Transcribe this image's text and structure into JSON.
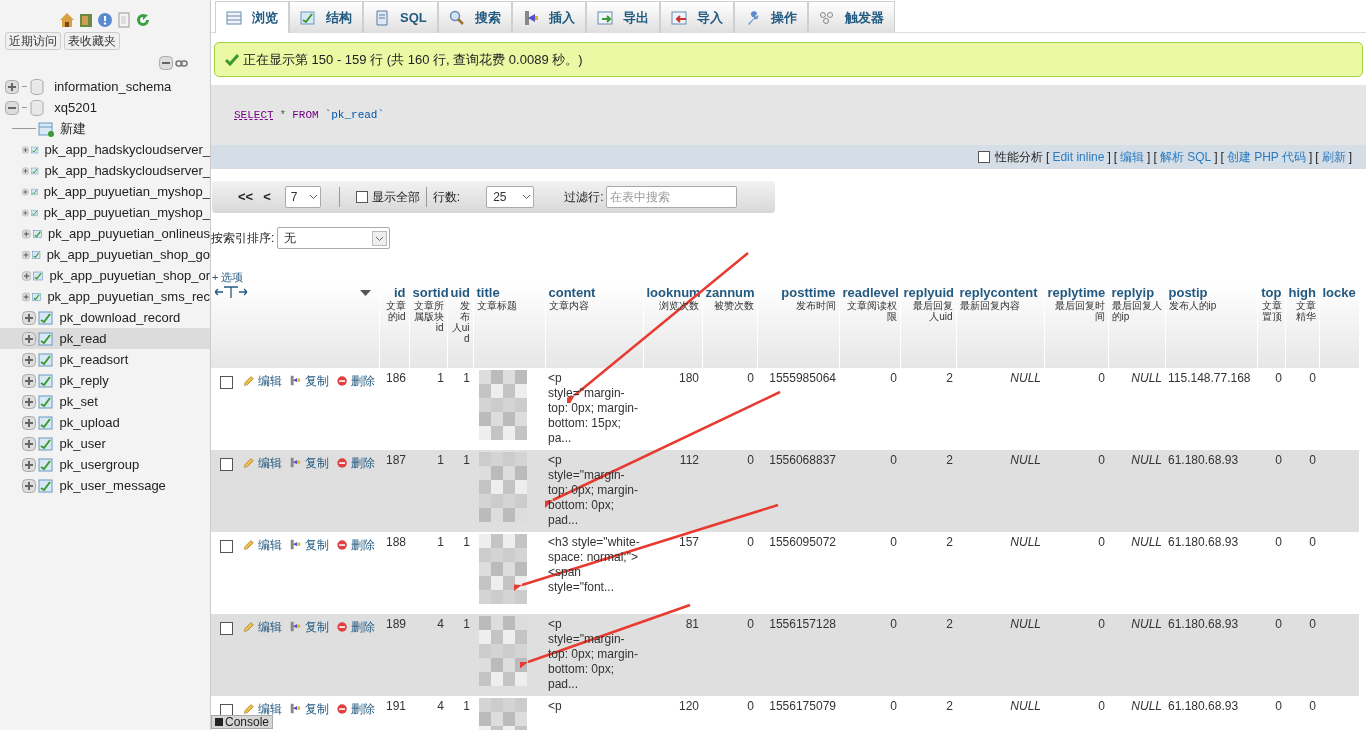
{
  "sidebar": {
    "buttons": [
      "近期访问",
      "表收藏夹"
    ],
    "tree": [
      {
        "label": "information_schema",
        "kind": "database",
        "expanded": false,
        "selected": false
      },
      {
        "label": "xq5201",
        "kind": "database",
        "expanded": true,
        "selected": false,
        "children": [
          {
            "label": "新建",
            "kind": "new",
            "selected": false
          },
          {
            "label": "pk_app_hadskycloudserver_",
            "kind": "table",
            "selected": false
          },
          {
            "label": "pk_app_hadskycloudserver_",
            "kind": "table",
            "selected": false
          },
          {
            "label": "pk_app_puyuetian_myshop_",
            "kind": "table",
            "selected": false
          },
          {
            "label": "pk_app_puyuetian_myshop_",
            "kind": "table",
            "selected": false
          },
          {
            "label": "pk_app_puyuetian_onlineus",
            "kind": "table",
            "selected": false
          },
          {
            "label": "pk_app_puyuetian_shop_go",
            "kind": "table",
            "selected": false
          },
          {
            "label": "pk_app_puyuetian_shop_or",
            "kind": "table",
            "selected": false
          },
          {
            "label": "pk_app_puyuetian_sms_rec",
            "kind": "table",
            "selected": false
          },
          {
            "label": "pk_download_record",
            "kind": "table",
            "selected": false
          },
          {
            "label": "pk_read",
            "kind": "table",
            "selected": true
          },
          {
            "label": "pk_readsort",
            "kind": "table",
            "selected": false
          },
          {
            "label": "pk_reply",
            "kind": "table",
            "selected": false
          },
          {
            "label": "pk_set",
            "kind": "table",
            "selected": false
          },
          {
            "label": "pk_upload",
            "kind": "table",
            "selected": false
          },
          {
            "label": "pk_user",
            "kind": "table",
            "selected": false
          },
          {
            "label": "pk_usergroup",
            "kind": "table",
            "selected": false
          },
          {
            "label": "pk_user_message",
            "kind": "table",
            "selected": false
          }
        ]
      }
    ]
  },
  "tabs": [
    {
      "label": "浏览",
      "selected": true
    },
    {
      "label": "结构",
      "selected": false
    },
    {
      "label": "SQL",
      "selected": false
    },
    {
      "label": "搜索",
      "selected": false
    },
    {
      "label": "插入",
      "selected": false
    },
    {
      "label": "导出",
      "selected": false
    },
    {
      "label": "导入",
      "selected": false
    },
    {
      "label": "操作",
      "selected": false
    },
    {
      "label": "触发器",
      "selected": false
    }
  ],
  "message": "正在显示第 150 - 159 行 (共 160 行, 查询花费 0.0089 秒。)",
  "sql": {
    "keyword1": "SELECT",
    "star": "*",
    "keyword2": "FROM",
    "table": "`pk_read`"
  },
  "query_links": {
    "checkbox_label": "性能分析",
    "checked": false,
    "links": [
      {
        "open": "[",
        "label": "Edit inline",
        "close": "]"
      },
      {
        "open": "[",
        "label": "编辑",
        "close": "]"
      },
      {
        "open": "[",
        "label": "解析 SQL",
        "close": "]"
      },
      {
        "open": "[",
        "label": "创建 PHP 代码",
        "close": "]"
      },
      {
        "open": "[",
        "label": "刷新",
        "close": "]"
      }
    ]
  },
  "navigation": {
    "first": "<<",
    "prev": "<",
    "page": "7",
    "show_all": "显示全部",
    "show_all_checked": false,
    "rows_label": "行数:",
    "rows": "25",
    "filter_label": "过滤行:",
    "filter_placeholder": "在表中搜索"
  },
  "sort": {
    "label": "按索引排序:",
    "value": "无"
  },
  "options_link": "+ 选项",
  "table": {
    "columns": [
      {
        "name": "id",
        "comment": "文章的id"
      },
      {
        "name": "sortid",
        "comment": "文章所属版块id"
      },
      {
        "name": "uid",
        "comment": "发布人uid"
      },
      {
        "name": "title",
        "comment": "文章标题"
      },
      {
        "name": "content",
        "comment": "文章内容"
      },
      {
        "name": "looknum",
        "comment": "浏览次数"
      },
      {
        "name": "zannum",
        "comment": "被赞次数"
      },
      {
        "name": "posttime",
        "comment": "发布时间"
      },
      {
        "name": "readlevel",
        "comment": "文章阅读权限"
      },
      {
        "name": "replyuid",
        "comment": "最后回复人uid"
      },
      {
        "name": "replycontent",
        "comment": "最新回复内容"
      },
      {
        "name": "replytime",
        "comment": "最后回复时间"
      },
      {
        "name": "replyip",
        "comment": "最后回复人的ip"
      },
      {
        "name": "postip",
        "comment": "发布人的ip"
      },
      {
        "name": "top",
        "comment": "文章置顶"
      },
      {
        "name": "high",
        "comment": "文章精华"
      },
      {
        "name": "locke"
      }
    ],
    "rows": [
      {
        "checked": false,
        "actions": [
          "编辑",
          "复制",
          "删除"
        ],
        "cells": [
          "186",
          "1",
          "1",
          "",
          "<p style=\"margin-top: 0px; margin-bottom: 15px; pa...",
          "180",
          "0",
          "1555985064",
          "0",
          "2",
          "NULL",
          "0",
          "NULL",
          "115.148.77.168",
          "0",
          "0"
        ]
      },
      {
        "checked": false,
        "actions": [
          "编辑",
          "复制",
          "删除"
        ],
        "cells": [
          "187",
          "1",
          "1",
          "",
          "<p style=\"margin-top: 0px; margin-bottom: 0px; pad...",
          "112",
          "0",
          "1556068837",
          "0",
          "2",
          "NULL",
          "0",
          "NULL",
          "61.180.68.93",
          "0",
          "0"
        ]
      },
      {
        "checked": false,
        "actions": [
          "编辑",
          "复制",
          "删除"
        ],
        "cells": [
          "188",
          "1",
          "1",
          "",
          "<h3 style=\"white-space: normal;\"> <span style=\"font...",
          "157",
          "0",
          "1556095072",
          "0",
          "2",
          "NULL",
          "0",
          "NULL",
          "61.180.68.93",
          "0",
          "0"
        ]
      },
      {
        "checked": false,
        "actions": [
          "编辑",
          "复制",
          "删除"
        ],
        "cells": [
          "189",
          "4",
          "1",
          "",
          "<p style=\"margin-top: 0px; margin-bottom: 0px; pad...",
          "81",
          "0",
          "1556157128",
          "0",
          "2",
          "NULL",
          "0",
          "NULL",
          "61.180.68.93",
          "0",
          "0"
        ]
      },
      {
        "checked": false,
        "actions": [
          "编辑",
          "复制",
          "删除"
        ],
        "cells": [
          "191",
          "4",
          "1",
          "",
          "<p",
          "120",
          "0",
          "1556175079",
          "0",
          "2",
          "NULL",
          "0",
          "NULL",
          "61.180.68.93",
          "0",
          "0"
        ]
      }
    ]
  },
  "console": "Console"
}
